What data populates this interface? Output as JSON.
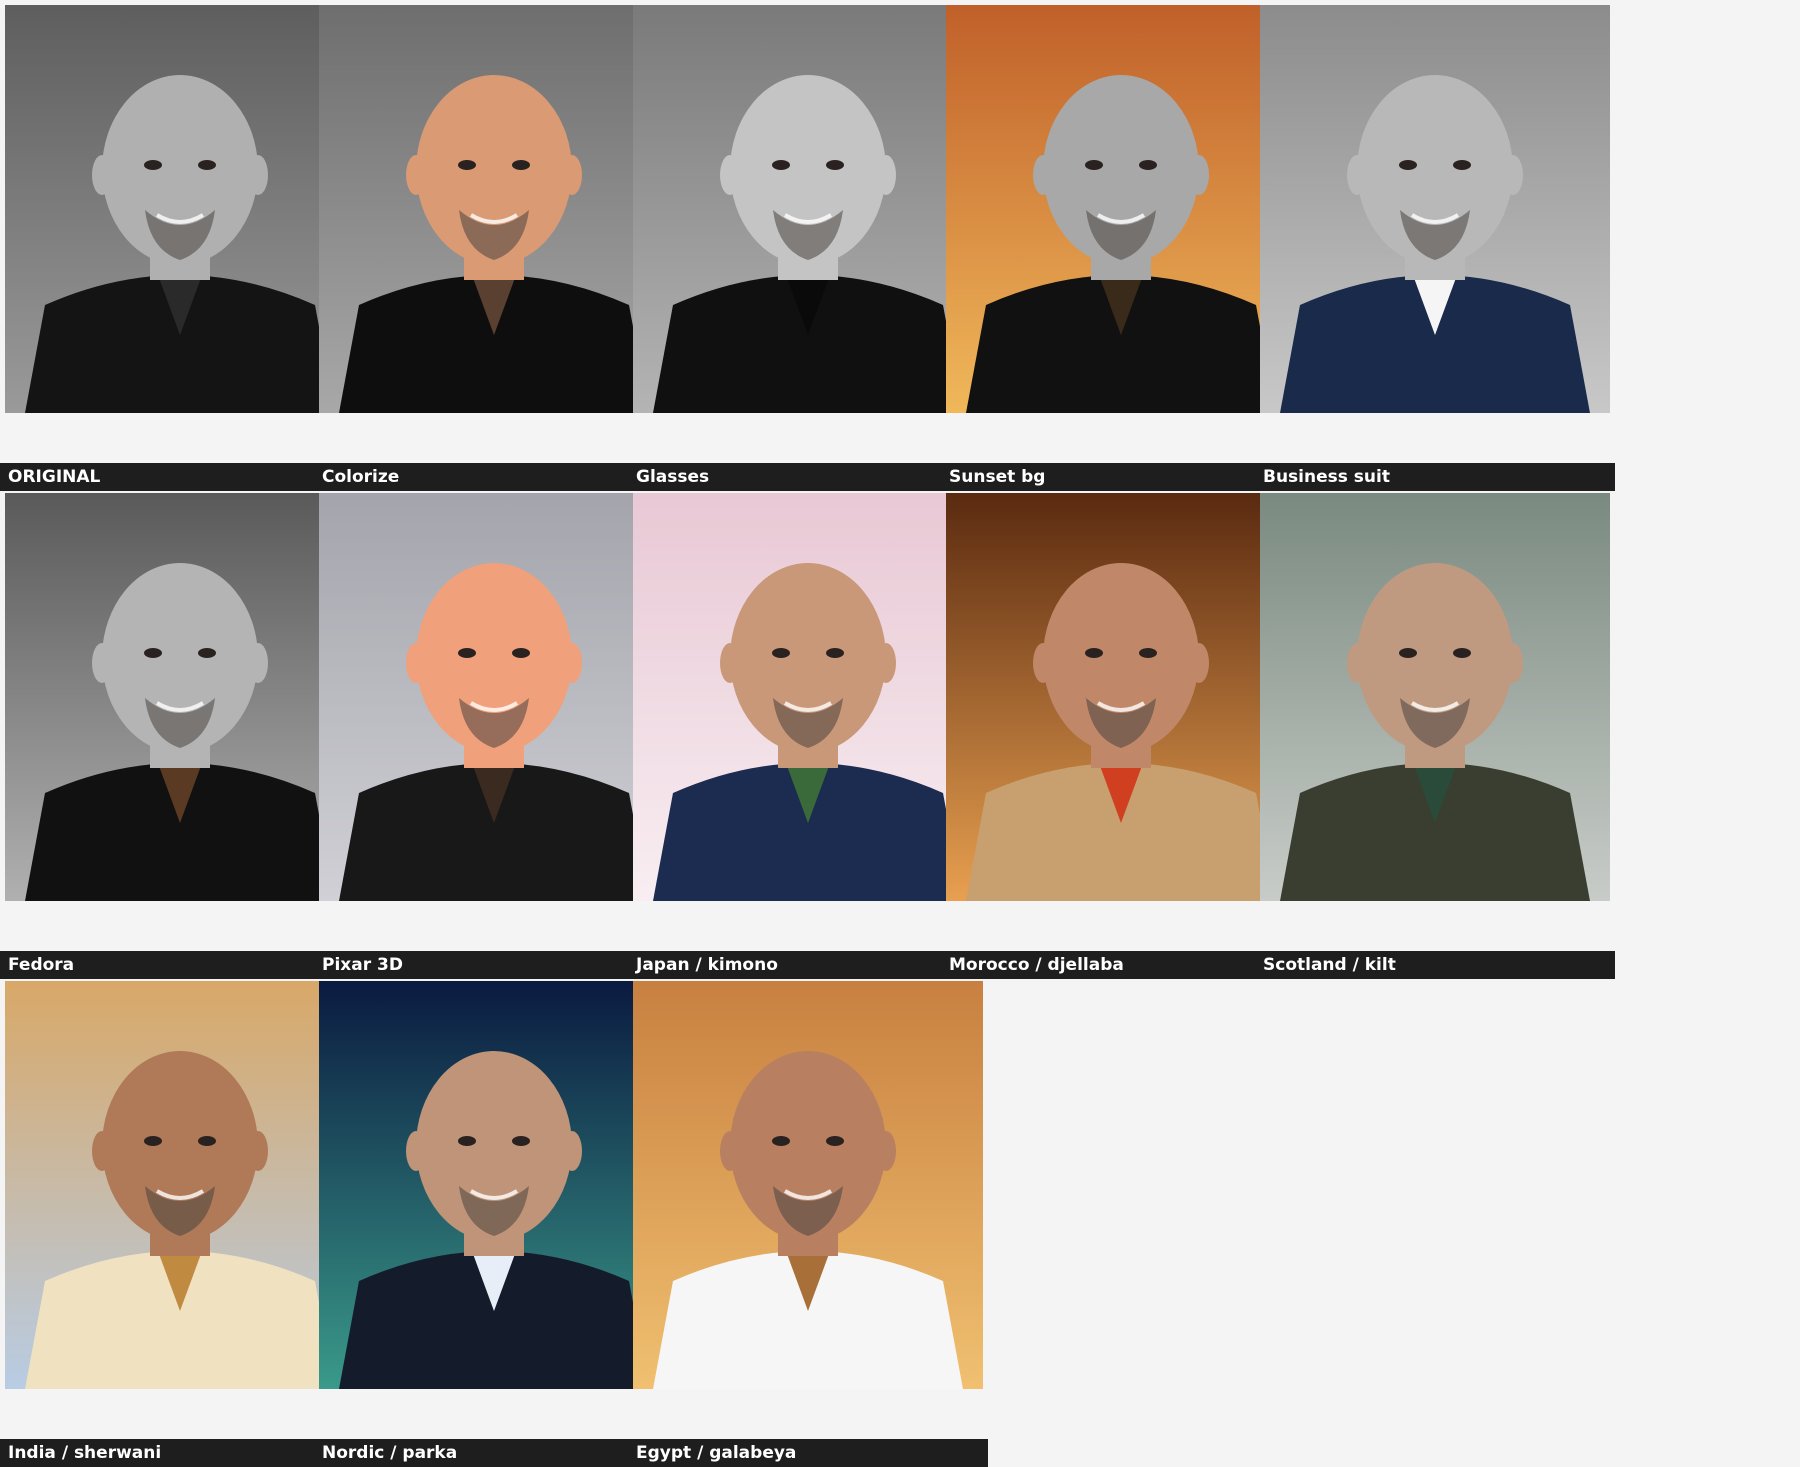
{
  "tiles": [
    {
      "caption": "ORIGINAL",
      "bg1": "#5e5e5e",
      "bg2": "#9a9a9a",
      "skin": "#b0b0b0",
      "cloth": "#141414",
      "accent": "#2a2a2a"
    },
    {
      "caption": "Colorize",
      "bg1": "#6e6e6e",
      "bg2": "#a8a8a8",
      "skin": "#d99a74",
      "cloth": "#0e0e0e",
      "accent": "#5a4030"
    },
    {
      "caption": "Glasses",
      "bg1": "#7a7a7a",
      "bg2": "#b4b4b4",
      "skin": "#c4c4c4",
      "cloth": "#101010",
      "accent": "#0a0a0a"
    },
    {
      "caption": "Sunset bg",
      "bg1": "#c0602a",
      "bg2": "#f0b85a",
      "skin": "#a8a8a8",
      "cloth": "#111111",
      "accent": "#3a2a1a"
    },
    {
      "caption": "Business suit",
      "bg1": "#8c8c8c",
      "bg2": "#c8c8c8",
      "skin": "#b8b8b8",
      "cloth": "#1a2a4a",
      "accent": "#f5f5f5"
    },
    {
      "caption": "Fedora",
      "bg1": "#5a5a5a",
      "bg2": "#b0b0b0",
      "skin": "#b4b4b4",
      "cloth": "#111111",
      "accent": "#5a3a22"
    },
    {
      "caption": "Pixar 3D",
      "bg1": "#a4a4ac",
      "bg2": "#d0d0d6",
      "skin": "#f0a07a",
      "cloth": "#181818",
      "accent": "#3a2a20"
    },
    {
      "caption": "Japan / kimono",
      "bg1": "#e8c8d4",
      "bg2": "#f8eef2",
      "skin": "#c99878",
      "cloth": "#1c2c50",
      "accent": "#3a6a3a"
    },
    {
      "caption": "Morocco / djellaba",
      "bg1": "#5a2a10",
      "bg2": "#e8a050",
      "skin": "#c08868",
      "cloth": "#c8a070",
      "accent": "#d04020"
    },
    {
      "caption": "Scotland / kilt",
      "bg1": "#7a8a80",
      "bg2": "#c8ccc8",
      "skin": "#c09a80",
      "cloth": "#3a3e30",
      "accent": "#2a4a3a"
    },
    {
      "caption": "India / sherwani",
      "bg1": "#d8a868",
      "bg2": "#b8cce4",
      "skin": "#b07a58",
      "cloth": "#f0e2c0",
      "accent": "#c08a40"
    },
    {
      "caption": "Nordic / parka",
      "bg1": "#0a1a40",
      "bg2": "#3a9a8a",
      "skin": "#c09478",
      "cloth": "#141c2c",
      "accent": "#e8eef8"
    },
    {
      "caption": "Egypt / galabeya",
      "bg1": "#c88040",
      "bg2": "#f0c070",
      "skin": "#b88060",
      "cloth": "#f6f6f6",
      "accent": "#a87038"
    }
  ]
}
